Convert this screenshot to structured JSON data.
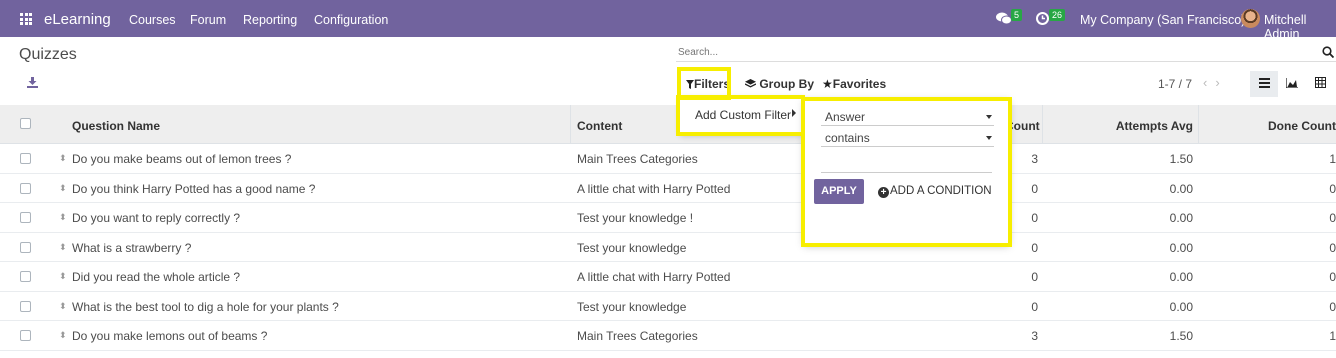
{
  "topbar": {
    "brand": "eLearning",
    "menu": [
      "Courses",
      "Forum",
      "Reporting",
      "Configuration"
    ],
    "messages_count": "5",
    "activities_count": "26",
    "company": "My Company (San Francisco)",
    "user": "Mitchell Admin",
    "background_color": "#71639e"
  },
  "control": {
    "page_title": "Quizzes",
    "search_placeholder": "Search...",
    "filters_label": "Filters",
    "group_by_label": "Group By",
    "favorites_label": "Favorites",
    "pager": "1-7 / 7"
  },
  "filters_menu": {
    "add_custom_filter": "Add Custom Filter",
    "field_value": "Answer",
    "operator_value": "contains",
    "value_input": "",
    "apply_label": "APPLY",
    "add_condition_label": "ADD A CONDITION"
  },
  "table": {
    "columns": [
      "Question Name",
      "Content",
      "Count",
      "Attempts Avg",
      "Done Count"
    ],
    "rows": [
      {
        "name": "Do you make beams out of lemon trees ?",
        "content": "Main Trees Categories",
        "count": "3",
        "avg": "1.50",
        "done": "1"
      },
      {
        "name": "Do you think Harry Potted has a good name ?",
        "content": "A little chat with Harry Potted",
        "count": "0",
        "avg": "0.00",
        "done": "0"
      },
      {
        "name": "Do you want to reply correctly ?",
        "content": "Test your knowledge !",
        "count": "0",
        "avg": "0.00",
        "done": "0"
      },
      {
        "name": "What is a strawberry ?",
        "content": "Test your knowledge",
        "count": "0",
        "avg": "0.00",
        "done": "0"
      },
      {
        "name": "Did you read the whole article ?",
        "content": "A little chat with Harry Potted",
        "count": "0",
        "avg": "0.00",
        "done": "0"
      },
      {
        "name": "What is the best tool to dig a hole for your plants ?",
        "content": "Test your knowledge",
        "count": "0",
        "avg": "0.00",
        "done": "0"
      },
      {
        "name": "Do you make lemons out of beams ?",
        "content": "Main Trees Categories",
        "count": "3",
        "avg": "1.50",
        "done": "1"
      }
    ]
  },
  "colors": {
    "highlight": "#f7ee00",
    "accent": "#71639e"
  },
  "icons": [
    "apps-icon",
    "chat-icon",
    "clock-icon",
    "download-icon",
    "search-icon",
    "filter-icon",
    "layers-icon",
    "star-icon",
    "list-view-icon",
    "graph-view-icon",
    "pivot-view-icon"
  ]
}
